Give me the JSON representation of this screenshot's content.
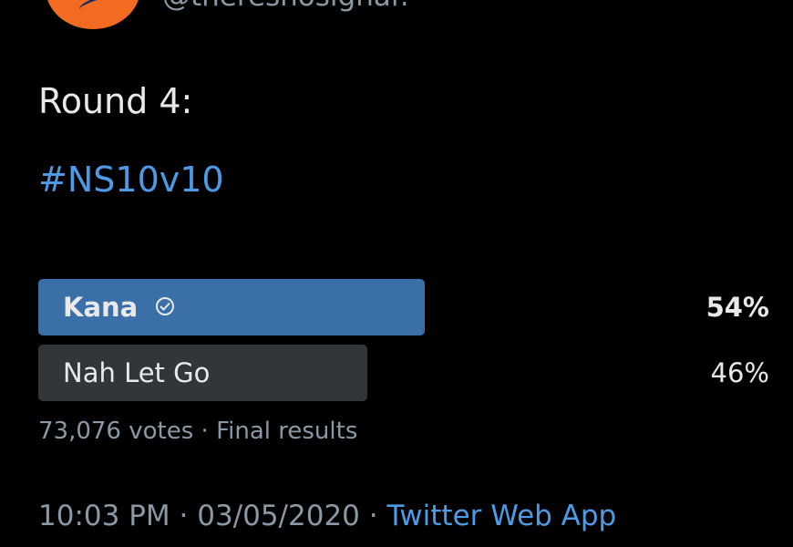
{
  "header": {
    "handle": "@theresnosignal!"
  },
  "tweet": {
    "text": "Round 4:",
    "hashtag": "#NS10v10"
  },
  "poll": {
    "options": [
      {
        "label": "Kana",
        "percent_label": "54%",
        "percent": 54,
        "winner": true
      },
      {
        "label": "Nah Let Go",
        "percent_label": "46%",
        "percent": 46,
        "winner": false
      }
    ],
    "votes": "73,076 votes",
    "separator": "·",
    "status": "Final results"
  },
  "footer": {
    "time": "10:03 PM",
    "separator1": "·",
    "date": "03/05/2020",
    "separator2": "·",
    "source": "Twitter Web App"
  },
  "colors": {
    "background": "#000000",
    "winner_bar": "#3a6fa8",
    "loser_bar": "#333639",
    "link": "#4d9be6",
    "muted": "#8b98a5",
    "avatar": "#f26b21"
  },
  "icons": {
    "winner_check": "check-circle-icon"
  }
}
